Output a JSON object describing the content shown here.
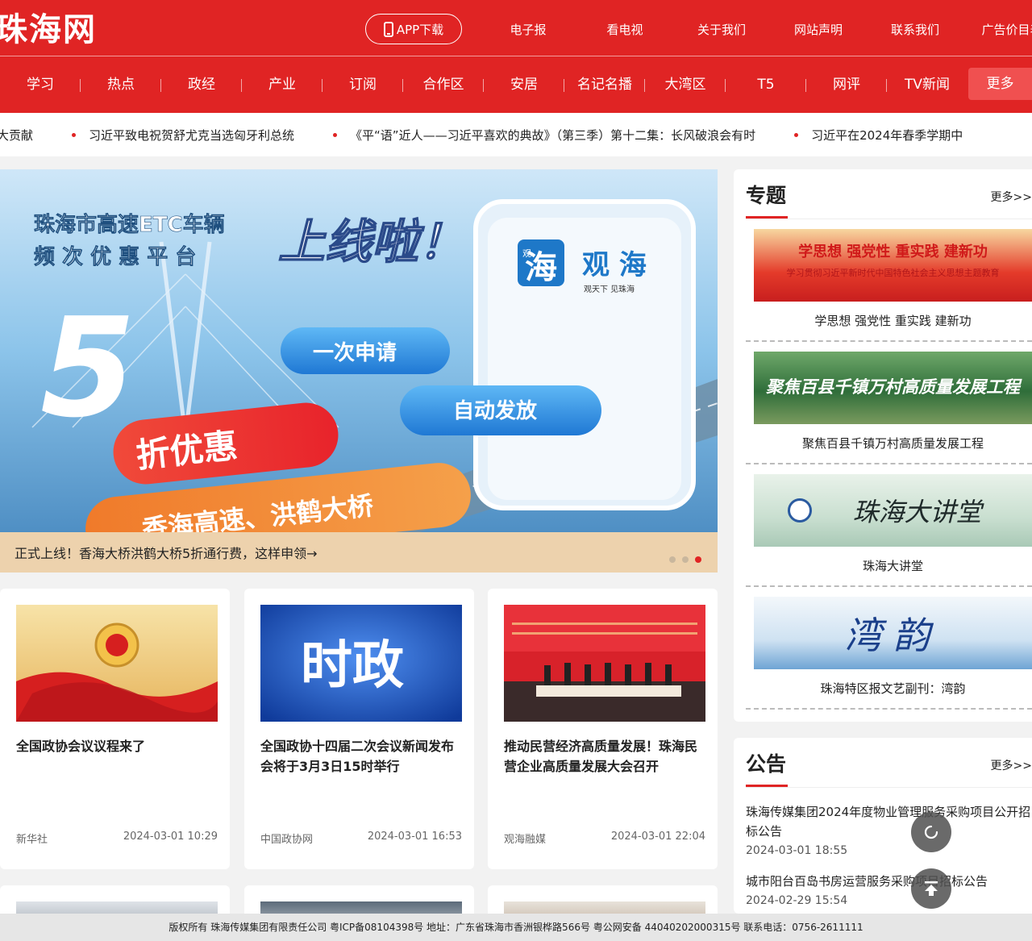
{
  "header": {
    "logo": "珠海网",
    "app_button": "APP下载",
    "top_links": [
      "电子报",
      "看电视",
      "关于我们",
      "网站声明",
      "联系我们",
      "广告价目表"
    ],
    "main_nav": [
      "学习",
      "热点",
      "政经",
      "产业",
      "订阅",
      "合作区",
      "安居",
      "名记名播",
      "大湾区",
      "T5",
      "网评",
      "TV新闻"
    ],
    "more": "更多"
  },
  "ticker": [
    "大贡献",
    "习近平致电祝贺舒尤克当选匈牙利总统",
    "《平“语”近人——习近平喜欢的典故》（第三季）第十二集：长风破浪会有时",
    "习近平在2024年春季学期中"
  ],
  "banner": {
    "caption": "正式上线！香海大桥洪鹤大桥5折通行费，这样申领→",
    "headline1": "珠海市高速ETC车辆",
    "headline2": "频 次 优 惠 平 台",
    "headline3": "上线啦！",
    "big_number": "5",
    "pill1": "一次申请",
    "pill2": "自动发放",
    "ribbon1": "折优惠",
    "ribbon2": "香海高速、洪鹤大桥",
    "app_name": "观 海",
    "app_slogan": "观天下  见珠海",
    "app_logo_char": "海",
    "app_logo_small": "观"
  },
  "cards": [
    {
      "title": "全国政协会议议程来了",
      "source": "新华社",
      "time": "2024-03-01 10:29"
    },
    {
      "title": "全国政协十四届二次会议新闻发布会将于3月3日15时举行",
      "source": "中国政协网",
      "time": "2024-03-01 16:53",
      "img_text": "时政"
    },
    {
      "title": "推动民营经济高质量发展！珠海民营企业高质量发展大会召开",
      "source": "观海融媒",
      "time": "2024-03-01 22:04"
    }
  ],
  "sidebar": {
    "topics_title": "专题",
    "topics_more": "更多>>",
    "topics": [
      {
        "label": "学思想 强党性 重实践 建新功",
        "img_main": "学思想   强党性   重实践   建新功",
        "img_sub": "学习贯彻习近平新时代中国特色社会主义思想主题教育"
      },
      {
        "label": "聚焦百县千镇万村高质量发展工程",
        "img_main": "聚焦百县千镇万村高质量发展工程"
      },
      {
        "label": "珠海大讲堂",
        "img_main": "珠海大讲堂"
      },
      {
        "label": "珠海特区报文艺副刊：湾韵",
        "img_main": "湾韵"
      }
    ],
    "notices_title": "公告",
    "notices_more": "更多>>",
    "notices": [
      {
        "title": "珠海传媒集团2024年度物业管理服务采购项目公开招标公告",
        "date": "2024-03-01 18:55"
      },
      {
        "title": "城市阳台百岛书房运营服务采购项目招标公告",
        "date": "2024-02-29 15:54"
      }
    ]
  },
  "footer": "版权所有 珠海传媒集团有限责任公司 粤ICP备08104398号 地址：广东省珠海市香洲银桦路566号 粤公网安备 44040202000315号 联系电话：0756-2611111",
  "colors": {
    "brand_red": "#e02424",
    "caption_bg": "#edd2ad"
  }
}
